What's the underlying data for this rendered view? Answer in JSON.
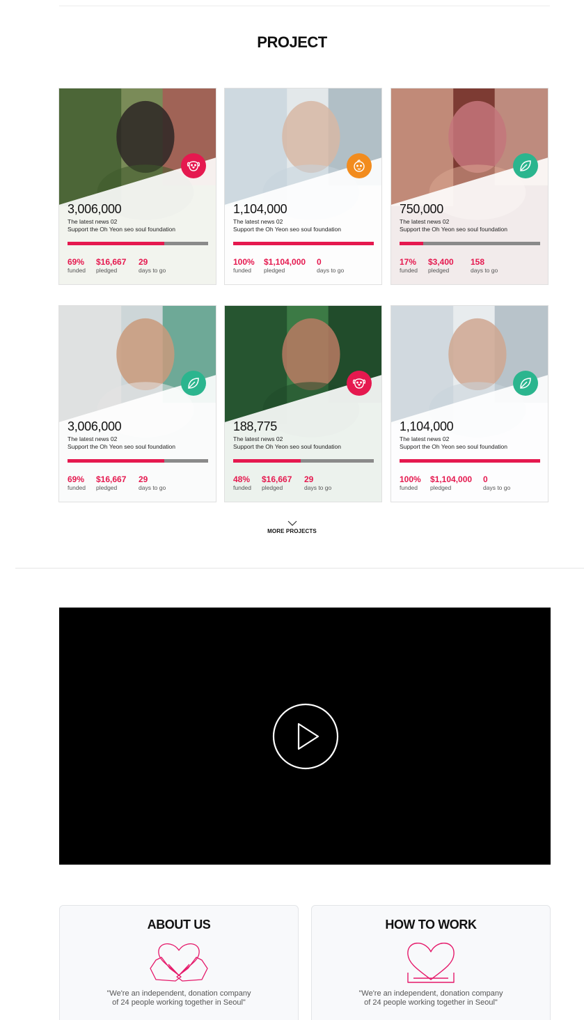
{
  "section_title": "PROJECT",
  "projects": [
    {
      "amount": "3,006,000",
      "news": "The latest news 02",
      "description": "Support the Oh Yeon seo soul foundation",
      "funded_pct": "69%",
      "funded_label": "funded",
      "pledged": "$16,667",
      "pledged_label": "pledged",
      "days": "29",
      "days_label": "days to go",
      "progress": 0.69,
      "icon": "dog-icon",
      "icon_color": "#e5194f"
    },
    {
      "amount": "1,104,000",
      "news": "The latest news 02",
      "description": "Support the Oh Yeon seo soul foundation",
      "funded_pct": "100%",
      "funded_label": "funded",
      "pledged": "$1,104,000",
      "pledged_label": "pledged",
      "days": "0",
      "days_label": "days to go",
      "progress": 1.0,
      "icon": "baby-icon",
      "icon_color": "#f28c1e"
    },
    {
      "amount": "750,000",
      "news": "The latest news 02",
      "description": "Support the Oh Yeon seo soul foundation",
      "funded_pct": "17%",
      "funded_label": "funded",
      "pledged": "$3,400",
      "pledged_label": "pledged",
      "days": "158",
      "days_label": "days to go",
      "progress": 0.17,
      "icon": "leaf-icon",
      "icon_color": "#2bb58e"
    },
    {
      "amount": "3,006,000",
      "news": "The latest news 02",
      "description": "Support the Oh Yeon seo soul foundation",
      "funded_pct": "69%",
      "funded_label": "funded",
      "pledged": "$16,667",
      "pledged_label": "pledged",
      "days": "29",
      "days_label": "days to go",
      "progress": 0.69,
      "icon": "leaf-icon",
      "icon_color": "#2bb58e"
    },
    {
      "amount": "188,775",
      "news": "The latest news 02",
      "description": "Support the Oh Yeon seo soul foundation",
      "funded_pct": "48%",
      "funded_label": "funded",
      "pledged": "$16,667",
      "pledged_label": "pledged",
      "days": "29",
      "days_label": "days to go",
      "progress": 0.48,
      "icon": "dog-icon",
      "icon_color": "#e5194f"
    },
    {
      "amount": "1,104,000",
      "news": "The latest news 02",
      "description": "Support the Oh Yeon seo soul foundation",
      "funded_pct": "100%",
      "funded_label": "funded",
      "pledged": "$1,104,000",
      "pledged_label": "pledged",
      "days": "0",
      "days_label": "days to go",
      "progress": 1.0,
      "icon": "leaf-icon",
      "icon_color": "#2bb58e"
    }
  ],
  "more_projects_label": "MORE PROJECTS",
  "video": {
    "play_icon": "play-icon"
  },
  "panels": [
    {
      "title": "ABOUT US",
      "quote_line1": "\"We're an independent, donation company",
      "quote_line2": "of 24 people working together in Seoul\"",
      "icon": "heart-hands-icon"
    },
    {
      "title": "HOW TO WORK",
      "quote_line1": "\"We're an independent, donation company",
      "quote_line2": "of 24 people working together in Seoul\"",
      "icon": "heart-stand-icon"
    }
  ],
  "colors": {
    "accent": "#e5194f",
    "track": "#8a8a8a",
    "video_bg": "#000000"
  }
}
